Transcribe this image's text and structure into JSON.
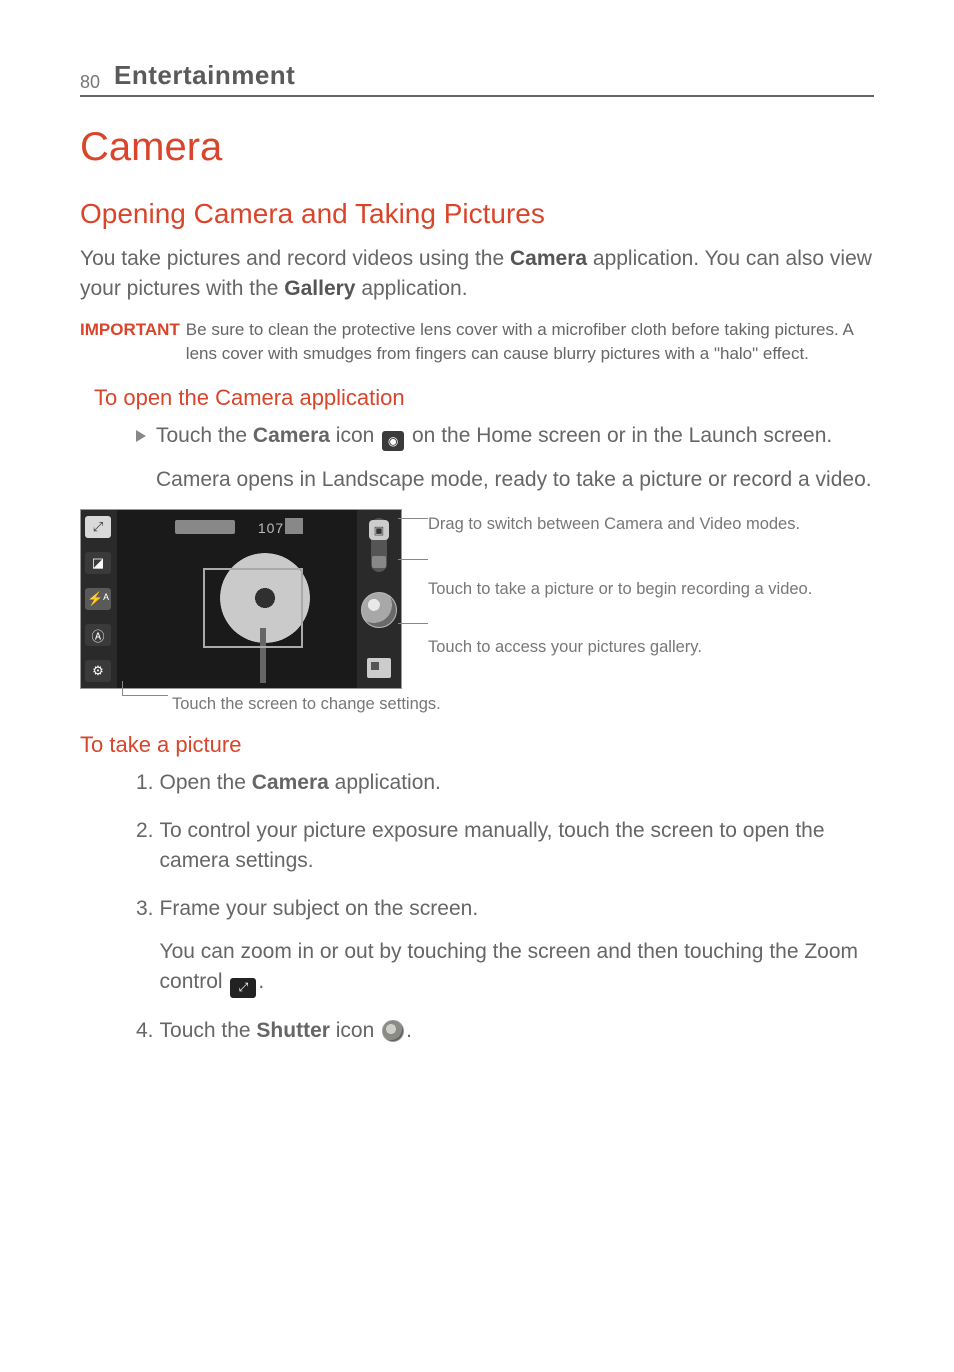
{
  "page_number": "80",
  "chapter_title": "Entertainment",
  "h1": "Camera",
  "h2": "Opening Camera and Taking Pictures",
  "intro_1a": "You take pictures and record videos using the ",
  "intro_1b": "Camera",
  "intro_1c": " application. You can also view your pictures with the ",
  "intro_1d": "Gallery",
  "intro_1e": " application.",
  "important_label": "IMPORTANT",
  "important_text": "Be sure to clean the protective lens cover with a microfiber cloth before taking pictures. A lens cover with smudges from fingers can cause blurry pictures with a \"halo\" effect.",
  "h3_open": "To open the Camera application",
  "open_bullet_a": "Touch the ",
  "open_bullet_b": "Camera",
  "open_bullet_c": " icon ",
  "open_bullet_d": " on the Home screen or in the Launch screen.",
  "open_cont": "Camera opens in Landscape mode, ready to take a picture or record a video.",
  "figure": {
    "shots_remaining": "1073",
    "callout_switch": "Drag to switch between Camera and Video modes.",
    "callout_shutter": "Touch to take a picture or to begin recording a video.",
    "callout_gallery": "Touch to access your pictures gallery.",
    "caption_below": "Touch the screen to change settings."
  },
  "h3_take": "To take a picture",
  "steps": {
    "s1a": "Open the ",
    "s1b": "Camera",
    "s1c": " application.",
    "s2": "To control your picture exposure manually, touch the screen to open the camera settings.",
    "s3": "Frame your subject on the screen.",
    "s3_sub_a": "You can zoom in or out by touching the screen and then touching the Zoom control ",
    "s3_sub_b": ".",
    "s4a": "Touch the ",
    "s4b": "Shutter",
    "s4c": " icon ",
    "s4d": "."
  },
  "numbers": {
    "n1": "1.",
    "n2": "2.",
    "n3": "3.",
    "n4": "4."
  }
}
